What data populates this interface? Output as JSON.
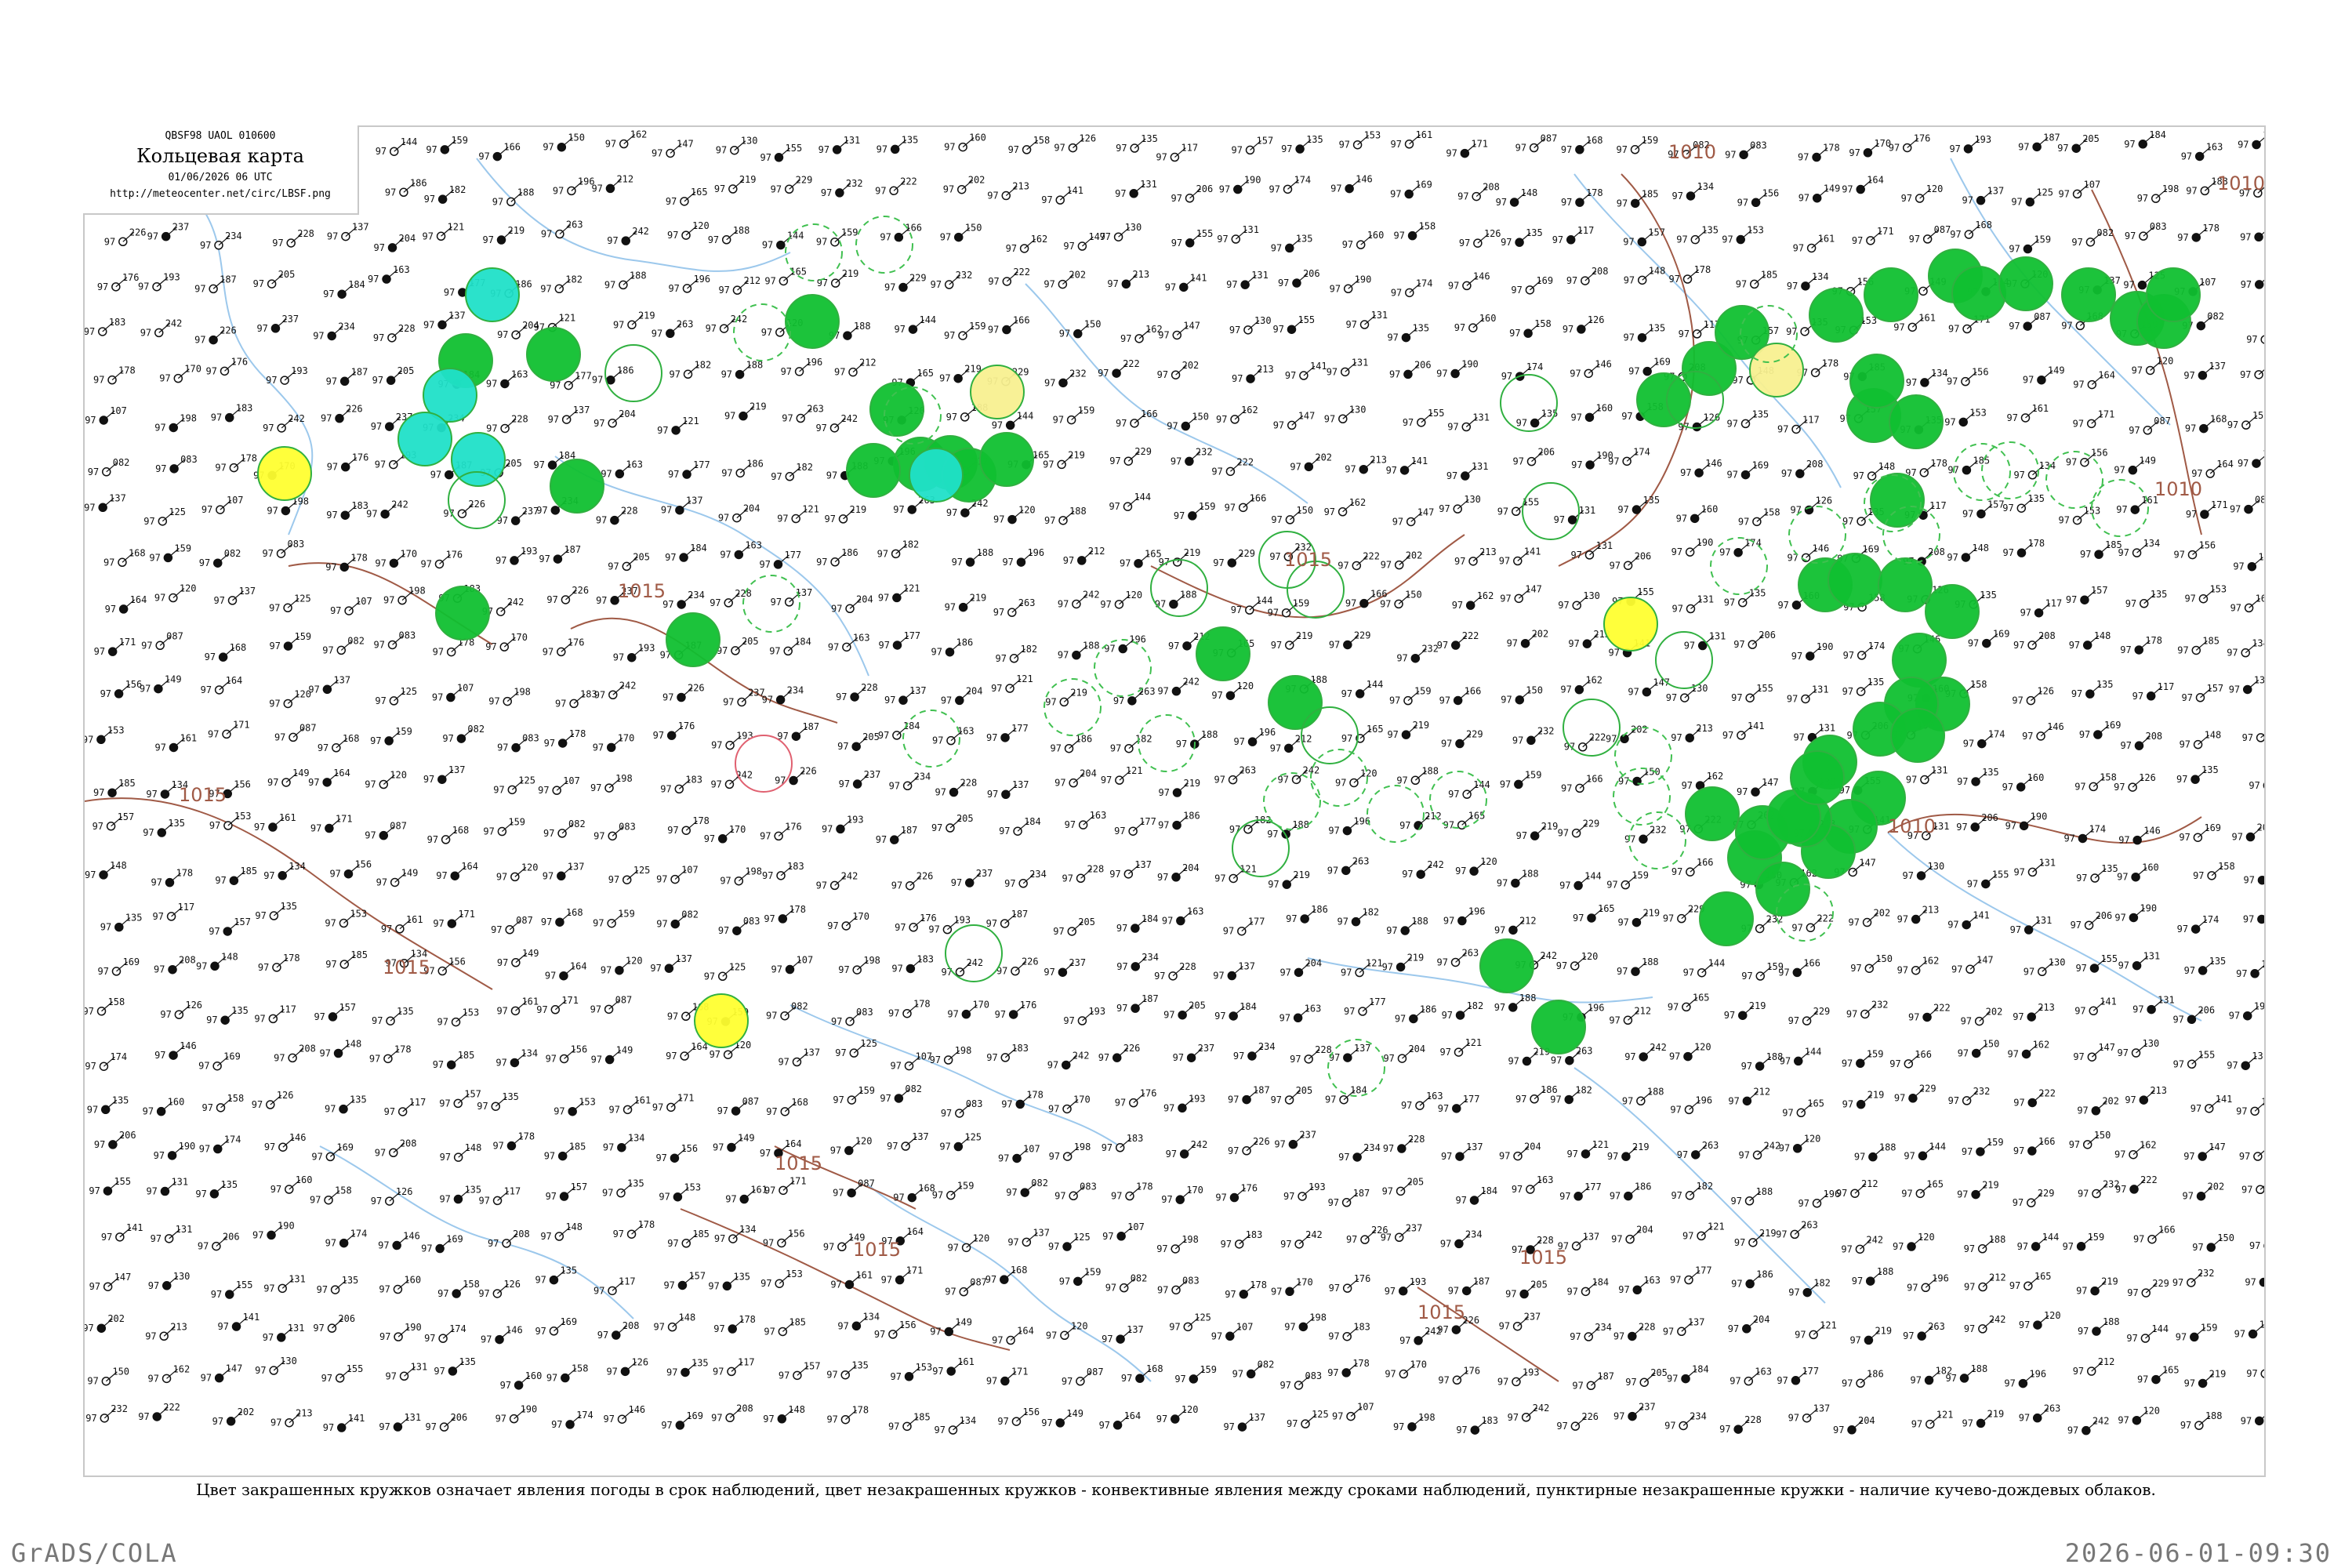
{
  "title_box": {
    "code": "QBSF98  UAOL  010600",
    "title": "Кольцевая карта",
    "datetime": "01/06/2026 06 UTC",
    "url": "http://meteocenter.net/circ/LBSF.png"
  },
  "caption": "Цвет закрашенных кружков означает явления погоды в срок наблюдений, цвет незакрашенных кружков - конвективные явления между сроками наблюдений, пунктирные незакрашенные кружки - наличие кучево-дождевых облаков.",
  "footer": {
    "left": "GrADS/COLA",
    "right": "2026-06-01-09:30"
  },
  "isobar_labels": [
    "1015",
    "1015",
    "1015",
    "1015",
    "1015",
    "1015",
    "1015",
    "1010",
    "1010",
    "1010",
    "1010",
    "1015"
  ],
  "colors": {
    "rain": "#10c030",
    "shower": "#20e0c8",
    "thunder": "#ffff30",
    "pale_thunder": "#f8f090",
    "convective_ring": "#30b040",
    "cb_ring": "#40c050",
    "red_ring": "#e06070",
    "isobar": "#a05a46",
    "river": "#9cc8ec"
  },
  "station_samples": [
    "144",
    "159",
    "166",
    "150",
    "162",
    "147",
    "130",
    "155",
    "131",
    "135",
    "160",
    "158",
    "126",
    "135",
    "117",
    "157",
    "135",
    "153",
    "161",
    "171",
    "087",
    "168",
    "159",
    "082",
    "083",
    "178",
    "170",
    "176",
    "193",
    "187",
    "205",
    "184",
    "163",
    "177",
    "186",
    "182",
    "188",
    "196",
    "212",
    "165",
    "219",
    "229",
    "232",
    "222",
    "202",
    "213",
    "141",
    "131",
    "206",
    "190",
    "174",
    "146",
    "169",
    "208",
    "148",
    "178",
    "185",
    "134",
    "156",
    "149",
    "164",
    "120",
    "137",
    "125",
    "107",
    "198",
    "183",
    "242",
    "226",
    "237",
    "234",
    "228",
    "137",
    "204",
    "121",
    "219",
    "263",
    "242",
    "120",
    "188"
  ]
}
